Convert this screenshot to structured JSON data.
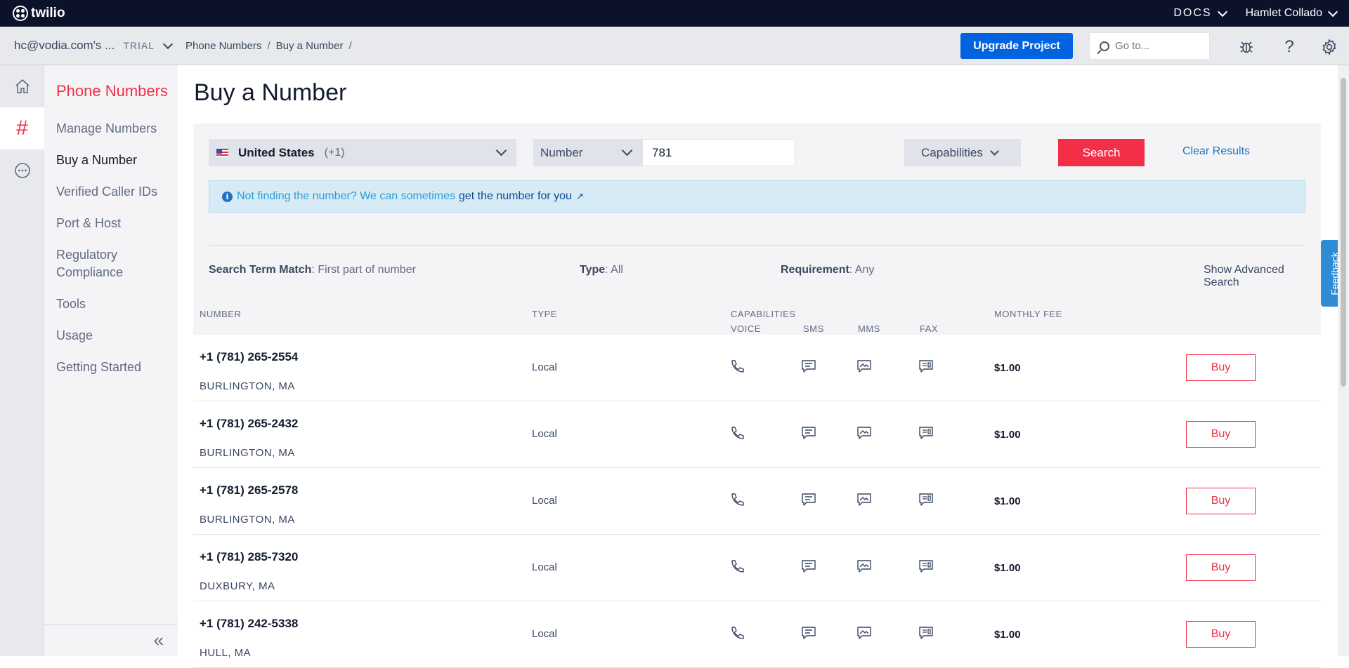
{
  "topbar": {
    "brand": "twilio",
    "docs": "DOCS",
    "user": "Hamlet Collado"
  },
  "subbar": {
    "account": "hc@vodia.com's ...",
    "trial": "TRIAL",
    "breadcrumbs": [
      "Phone Numbers",
      "Buy a Number"
    ],
    "upgrade_label": "Upgrade Project",
    "goto_placeholder": "Go to..."
  },
  "sidenav": {
    "title": "Phone Numbers",
    "items": [
      {
        "label": "Manage Numbers"
      },
      {
        "label": "Buy a Number"
      },
      {
        "label": "Verified Caller IDs"
      },
      {
        "label": "Port & Host"
      },
      {
        "label": "Regulatory Compliance"
      },
      {
        "label": "Tools"
      },
      {
        "label": "Usage"
      },
      {
        "label": "Getting Started"
      }
    ],
    "collapse": "«"
  },
  "main": {
    "title": "Buy a Number",
    "search": {
      "country": "United States",
      "country_code": "(+1)",
      "number_type": "Number",
      "number_value": "781",
      "capabilities_label": "Capabilities",
      "search_label": "Search",
      "clear_label": "Clear Results"
    },
    "notice": {
      "text": "Not finding the number? We can sometimes",
      "link": "get the number for you",
      "arrow": "↗"
    },
    "filters": {
      "search_term_label": "Search Term Match",
      "search_term_value": ": First part of number",
      "type_label": "Type",
      "type_value": ": All",
      "requirement_label": "Requirement",
      "requirement_value": ": Any",
      "advanced": "Show Advanced Search"
    },
    "table": {
      "headers": {
        "number": "NUMBER",
        "type": "TYPE",
        "capabilities": "CAPABILITIES",
        "voice": "VOICE",
        "sms": "SMS",
        "mms": "MMS",
        "fax": "FAX",
        "fee": "MONTHLY FEE"
      },
      "buy_label": "Buy",
      "rows": [
        {
          "number": "+1 (781) 265-2554",
          "locality": "BURLINGTON, MA",
          "type": "Local",
          "fee": "$1.00"
        },
        {
          "number": "+1 (781) 265-2432",
          "locality": "BURLINGTON, MA",
          "type": "Local",
          "fee": "$1.00"
        },
        {
          "number": "+1 (781) 265-2578",
          "locality": "BURLINGTON, MA",
          "type": "Local",
          "fee": "$1.00"
        },
        {
          "number": "+1 (781) 285-7320",
          "locality": "DUXBURY, MA",
          "type": "Local",
          "fee": "$1.00"
        },
        {
          "number": "+1 (781) 242-5338",
          "locality": "HULL, MA",
          "type": "Local",
          "fee": "$1.00"
        }
      ]
    }
  },
  "feedback": "Feedback",
  "colors": {
    "brand_red": "#f22f46",
    "primary_blue": "#0263e0",
    "topbar": "#0d122b"
  }
}
